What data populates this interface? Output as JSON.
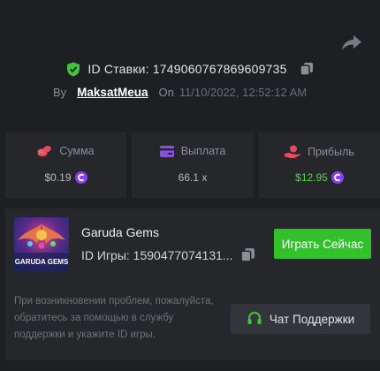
{
  "bet": {
    "prefix": "ID Ставки:",
    "id": "1749060767869609735",
    "text": "ID Ставки: 1749060767869609735"
  },
  "meta": {
    "by_label": "By",
    "username": "MaksatMeua",
    "on_label": "On",
    "datetime": "11/10/2022, 12:52:12 AM"
  },
  "stats": [
    {
      "label": "Сумма",
      "value": "$0.19",
      "icon": "coins-icon",
      "currency_icon": "coin-c-icon"
    },
    {
      "label": "Выплата",
      "value": "66.1 x",
      "icon": "wallet-icon"
    },
    {
      "label": "Прибыль",
      "value": "$12.95",
      "icon": "hand-money-icon",
      "currency_icon": "coin-c-icon"
    }
  ],
  "game": {
    "name": "Garuda Gems",
    "id_text": "ID Игры: 1590477074131...",
    "thumb_title": "GARUDA GEMS",
    "play_label": "Играть Сейчас"
  },
  "help": {
    "text": "При возникновении проблем, пожалуйста, обратитесь за помощью в службу поддержки и укажите ID игры.",
    "support_label": "Чат Поддержки"
  },
  "colors": {
    "background": "#1e1f23",
    "card": "#26272b",
    "accent_green": "#32c12b",
    "profit_green": "#5ad14a",
    "coin_purple": "#8a3ff0",
    "icon_red": "#e84c5c",
    "icon_purple": "#8a4ee8"
  }
}
